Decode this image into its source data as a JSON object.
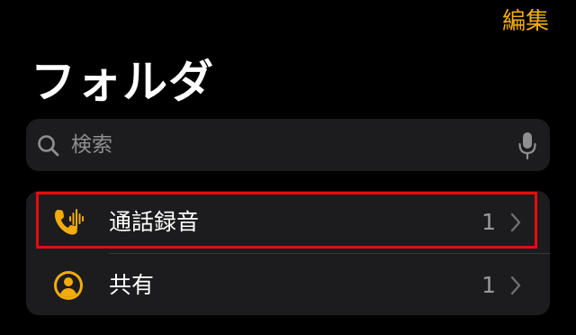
{
  "header": {
    "edit_label": "編集",
    "title": "フォルダ"
  },
  "search": {
    "placeholder": "検索",
    "value": ""
  },
  "folders": [
    {
      "label": "通話録音",
      "count": "1",
      "icon": "phone-waveform-icon",
      "highlighted": true
    },
    {
      "label": "共有",
      "count": "1",
      "icon": "person-circle-icon",
      "highlighted": false
    }
  ],
  "colors": {
    "accent": "#f2ac0d",
    "background": "#000000",
    "card": "#1c1c1e",
    "highlight_border": "#e50d0d"
  }
}
